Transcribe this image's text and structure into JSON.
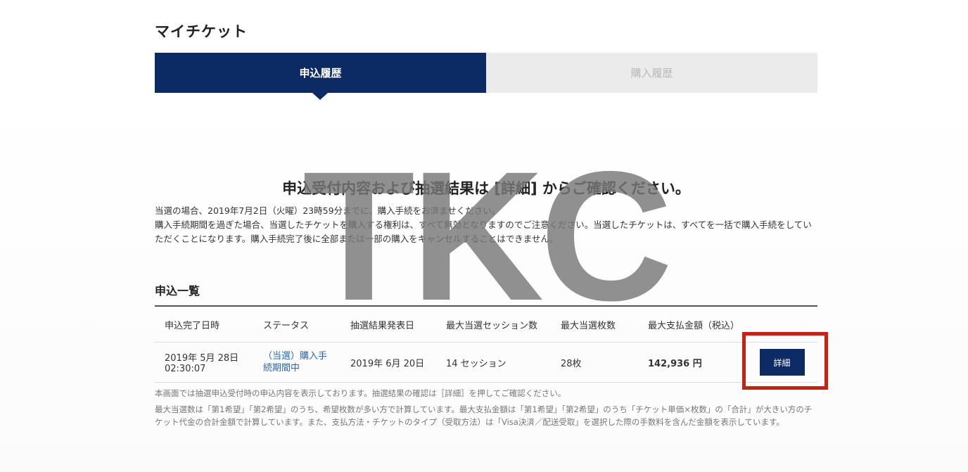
{
  "page": {
    "title": "マイチケット"
  },
  "tabs": [
    {
      "label": "申込履歴",
      "active": true
    },
    {
      "label": "購入履歴",
      "active": false
    }
  ],
  "headline": "申込受付内容および抽選結果は [詳細] からご確認ください。",
  "notice": {
    "line1": "当選の場合、2019年7月2日（火曜）23時59分までに、購入手続をお済ませください。",
    "line2": "購入手続期間を過ぎた場合、当選したチケットを購入する権利は、すべて無効となりますのでご注意ください。当選したチケットは、すべてを一括で購入手続をしていただくことになります。購入手続完了後に全部または一部の購入をキャンセルすることはできません。"
  },
  "section": {
    "title": "申込一覧"
  },
  "table": {
    "headers": [
      "申込完了日時",
      "ステータス",
      "抽選結果発表日",
      "最大当選セッション数",
      "最大当選枚数",
      "最大支払金額（税込）"
    ],
    "rows": [
      {
        "date_line1": "2019年 5月 28日",
        "date_line2": "02:30:07",
        "status_line1": "（当選）購入手",
        "status_line2": "続期間中",
        "result_date": "2019年 6月 20日",
        "sessions": "14 セッション",
        "tickets": "28枚",
        "amount": "142,936 円",
        "detail_label": "詳細"
      }
    ]
  },
  "footnotes": {
    "note1": "本画面では抽選申込受付時の申込内容を表示しております。抽選結果の確認は［詳細］を押してご確認ください。",
    "note2": "最大当選数は「第1希望」「第2希望」のうち、希望枚数が多い方で計算しています。最大支払金額は「第1希望」「第2希望」のうち「チケット単価×枚数」の「合計」が大きい方のチケット代金の合計金額で計算しています。また、支払方法・チケットのタイプ（受取方法）は「Visa決済／配送受取」を選択した際の手数料を含んだ金額を表示しています。"
  },
  "watermark": {
    "text": "TKC"
  },
  "colors": {
    "primary": "#0c2a63",
    "tab_inactive_bg": "#ebebeb",
    "link": "#2a66b3",
    "highlight": "#cc1f12"
  }
}
